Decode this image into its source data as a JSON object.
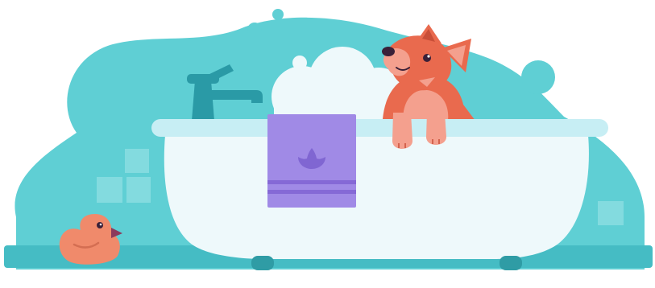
{
  "illustration": {
    "subject": "dog-in-bathtub",
    "icons": [
      "bathtub-icon",
      "faucet-icon",
      "towel-icon",
      "rubber-duck-icon",
      "dog-icon",
      "bubble-icon",
      "wall-tile-icon"
    ],
    "colors": {
      "background": "#ffffff",
      "blob": "#5fcfd4",
      "blob_dark": "#4bbfc6",
      "floor": "#45bcc4",
      "tile": "#8fdfe3",
      "tub_body": "#eef9fb",
      "tub_rim": "#c7eef4",
      "tub_feet": "#2f9ca5",
      "foam": "#eef9fb",
      "faucet": "#2a9aa6",
      "towel": "#a08ae6",
      "towel_stripe": "#8569d6",
      "towel_emblem": "#8066d2",
      "dog_fur": "#e96a4e",
      "dog_light": "#f4a08e",
      "dog_dark": "#c94f38",
      "duck": "#f08a6b",
      "duck_beak": "#8c3a5c",
      "eye": "#3a2038"
    }
  }
}
